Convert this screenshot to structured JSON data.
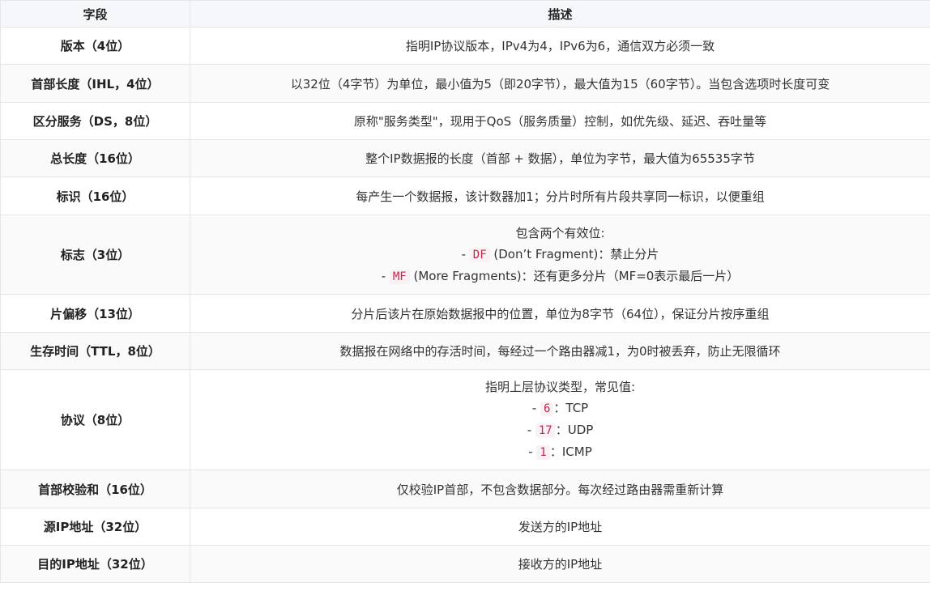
{
  "header": {
    "col_field": "字段",
    "col_desc": "描述"
  },
  "rows": [
    {
      "field": "版本（4位）",
      "desc": "指明IP协议版本，IPv4为4，IPv6为6，通信双方必须一致"
    },
    {
      "field": "首部长度（IHL，4位）",
      "desc": "以32位（4字节）为单位，最小值为5（即20字节），最大值为15（60字节）。当包含选项时长度可变"
    },
    {
      "field": "区分服务（DS，8位）",
      "desc": "原称\"服务类型\"，现用于QoS（服务质量）控制，如优先级、延迟、吞吐量等"
    },
    {
      "field": "总长度（16位）",
      "desc": "整个IP数据报的长度（首部 + 数据），单位为字节，最大值为65535字节"
    },
    {
      "field": "标识（16位）",
      "desc": "每产生一个数据报，该计数器加1；分片时所有片段共享同一标识，以便重组"
    },
    {
      "field": "标志（3位）",
      "desc_intro": "包含两个有效位:",
      "items": [
        {
          "prefix": "- ",
          "code": "DF",
          "text": " (Don’t Fragment)：禁止分片"
        },
        {
          "prefix": "- ",
          "code": "MF",
          "text": " (More Fragments)：还有更多分片（MF=0表示最后一片）"
        }
      ]
    },
    {
      "field": "片偏移（13位）",
      "desc": "分片后该片在原始数据报中的位置，单位为8字节（64位），保证分片按序重组"
    },
    {
      "field": "生存时间（TTL，8位）",
      "desc": "数据报在网络中的存活时间，每经过一个路由器减1，为0时被丢弃，防止无限循环"
    },
    {
      "field": "协议（8位）",
      "desc_intro": "指明上层协议类型，常见值:",
      "items": [
        {
          "prefix": "- ",
          "code": "6",
          "text": "：TCP"
        },
        {
          "prefix": "- ",
          "code": "17",
          "text": "：UDP"
        },
        {
          "prefix": "- ",
          "code": "1",
          "text": "：ICMP"
        }
      ]
    },
    {
      "field": "首部校验和（16位）",
      "desc": "仅校验IP首部，不包含数据部分。每次经过路由器需重新计算"
    },
    {
      "field": "源IP地址（32位）",
      "desc": "发送方的IP地址"
    },
    {
      "field": "目的IP地址（32位）",
      "desc": "接收方的IP地址"
    }
  ]
}
